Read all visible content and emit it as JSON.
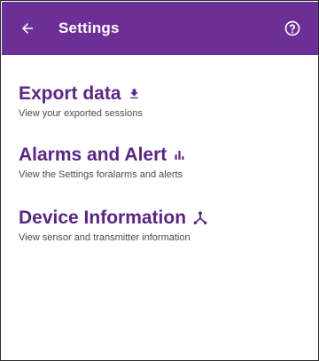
{
  "header": {
    "title": "Settings",
    "back_icon": "arrow-back-icon",
    "help_icon": "help-circle-icon",
    "background_color": "#6b2f96"
  },
  "items": [
    {
      "title": "Export data",
      "subtitle": "View your exported sessions",
      "icon": "download-icon"
    },
    {
      "title": "Alarms and Alert",
      "subtitle": "View the Settings foralarms and alerts",
      "icon": "bar-chart-icon"
    },
    {
      "title": "Device Information",
      "subtitle": "View sensor and transmitter information",
      "icon": "device-hub-icon"
    }
  ],
  "colors": {
    "accent": "#5a2684",
    "subtitle_text": "#4a4a4a"
  }
}
